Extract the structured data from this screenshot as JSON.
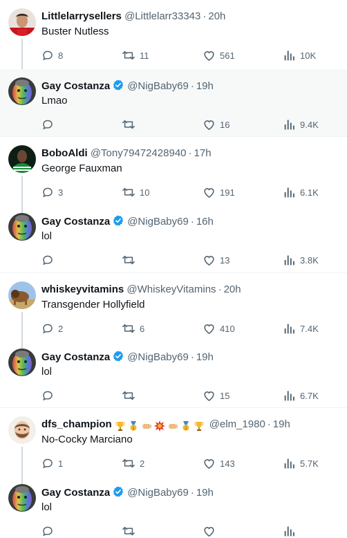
{
  "tweets": [
    {
      "name": "Littlelarrysellers",
      "handle": "@Littlelarr33343",
      "time": "20h",
      "text": "Buster Nutless",
      "replies": "8",
      "retweets": "11",
      "likes": "561",
      "views": "10K",
      "verified": false,
      "avatar": "red-shirt-person"
    },
    {
      "name": "Gay Costanza",
      "handle": "@NigBaby69",
      "time": "19h",
      "text": "Lmao",
      "replies": "",
      "retweets": "",
      "likes": "16",
      "views": "9.4K",
      "verified": true,
      "avatar": "rainbow-face"
    },
    {
      "name": "BoboAldi",
      "handle": "@Tony79472428940",
      "time": "17h",
      "text": "George Fauxman",
      "replies": "3",
      "retweets": "10",
      "likes": "191",
      "views": "6.1K",
      "verified": false,
      "avatar": "green-jersey-person"
    },
    {
      "name": "Gay Costanza",
      "handle": "@NigBaby69",
      "time": "16h",
      "text": "lol",
      "replies": "",
      "retweets": "",
      "likes": "13",
      "views": "3.8K",
      "verified": true,
      "avatar": "rainbow-face"
    },
    {
      "name": "whiskeyvitamins",
      "handle": "@WhiskeyVitamins",
      "time": "20h",
      "text": "Transgender Hollyfield",
      "replies": "2",
      "retweets": "6",
      "likes": "410",
      "views": "7.4K",
      "verified": false,
      "avatar": "lion-savanna"
    },
    {
      "name": "Gay Costanza",
      "handle": "@NigBaby69",
      "time": "19h",
      "text": "lol",
      "replies": "",
      "retweets": "",
      "likes": "15",
      "views": "6.7K",
      "verified": true,
      "avatar": "rainbow-face"
    },
    {
      "name": "dfs_champion",
      "handle": "@elm_1980",
      "time": "19h",
      "text": "No-Cocky  Marciano",
      "replies": "1",
      "retweets": "2",
      "likes": "143",
      "views": "5.7K",
      "verified": false,
      "avatar": "bearded-cartoon",
      "emojis": [
        "trophy",
        "gold-medal",
        "fist-bump",
        "collision",
        "fist-bump",
        "gold-medal",
        "trophy"
      ]
    },
    {
      "name": "Gay Costanza",
      "handle": "@NigBaby69",
      "time": "19h",
      "text": "lol",
      "verified": true,
      "avatar": "rainbow-face"
    }
  ],
  "separator": "·",
  "colors": {
    "text": "#0f1419",
    "muted": "#536471",
    "verified": "#1d9bf0",
    "thread_line": "#cfd9de",
    "highlight_bg": "#f7f9f9"
  }
}
